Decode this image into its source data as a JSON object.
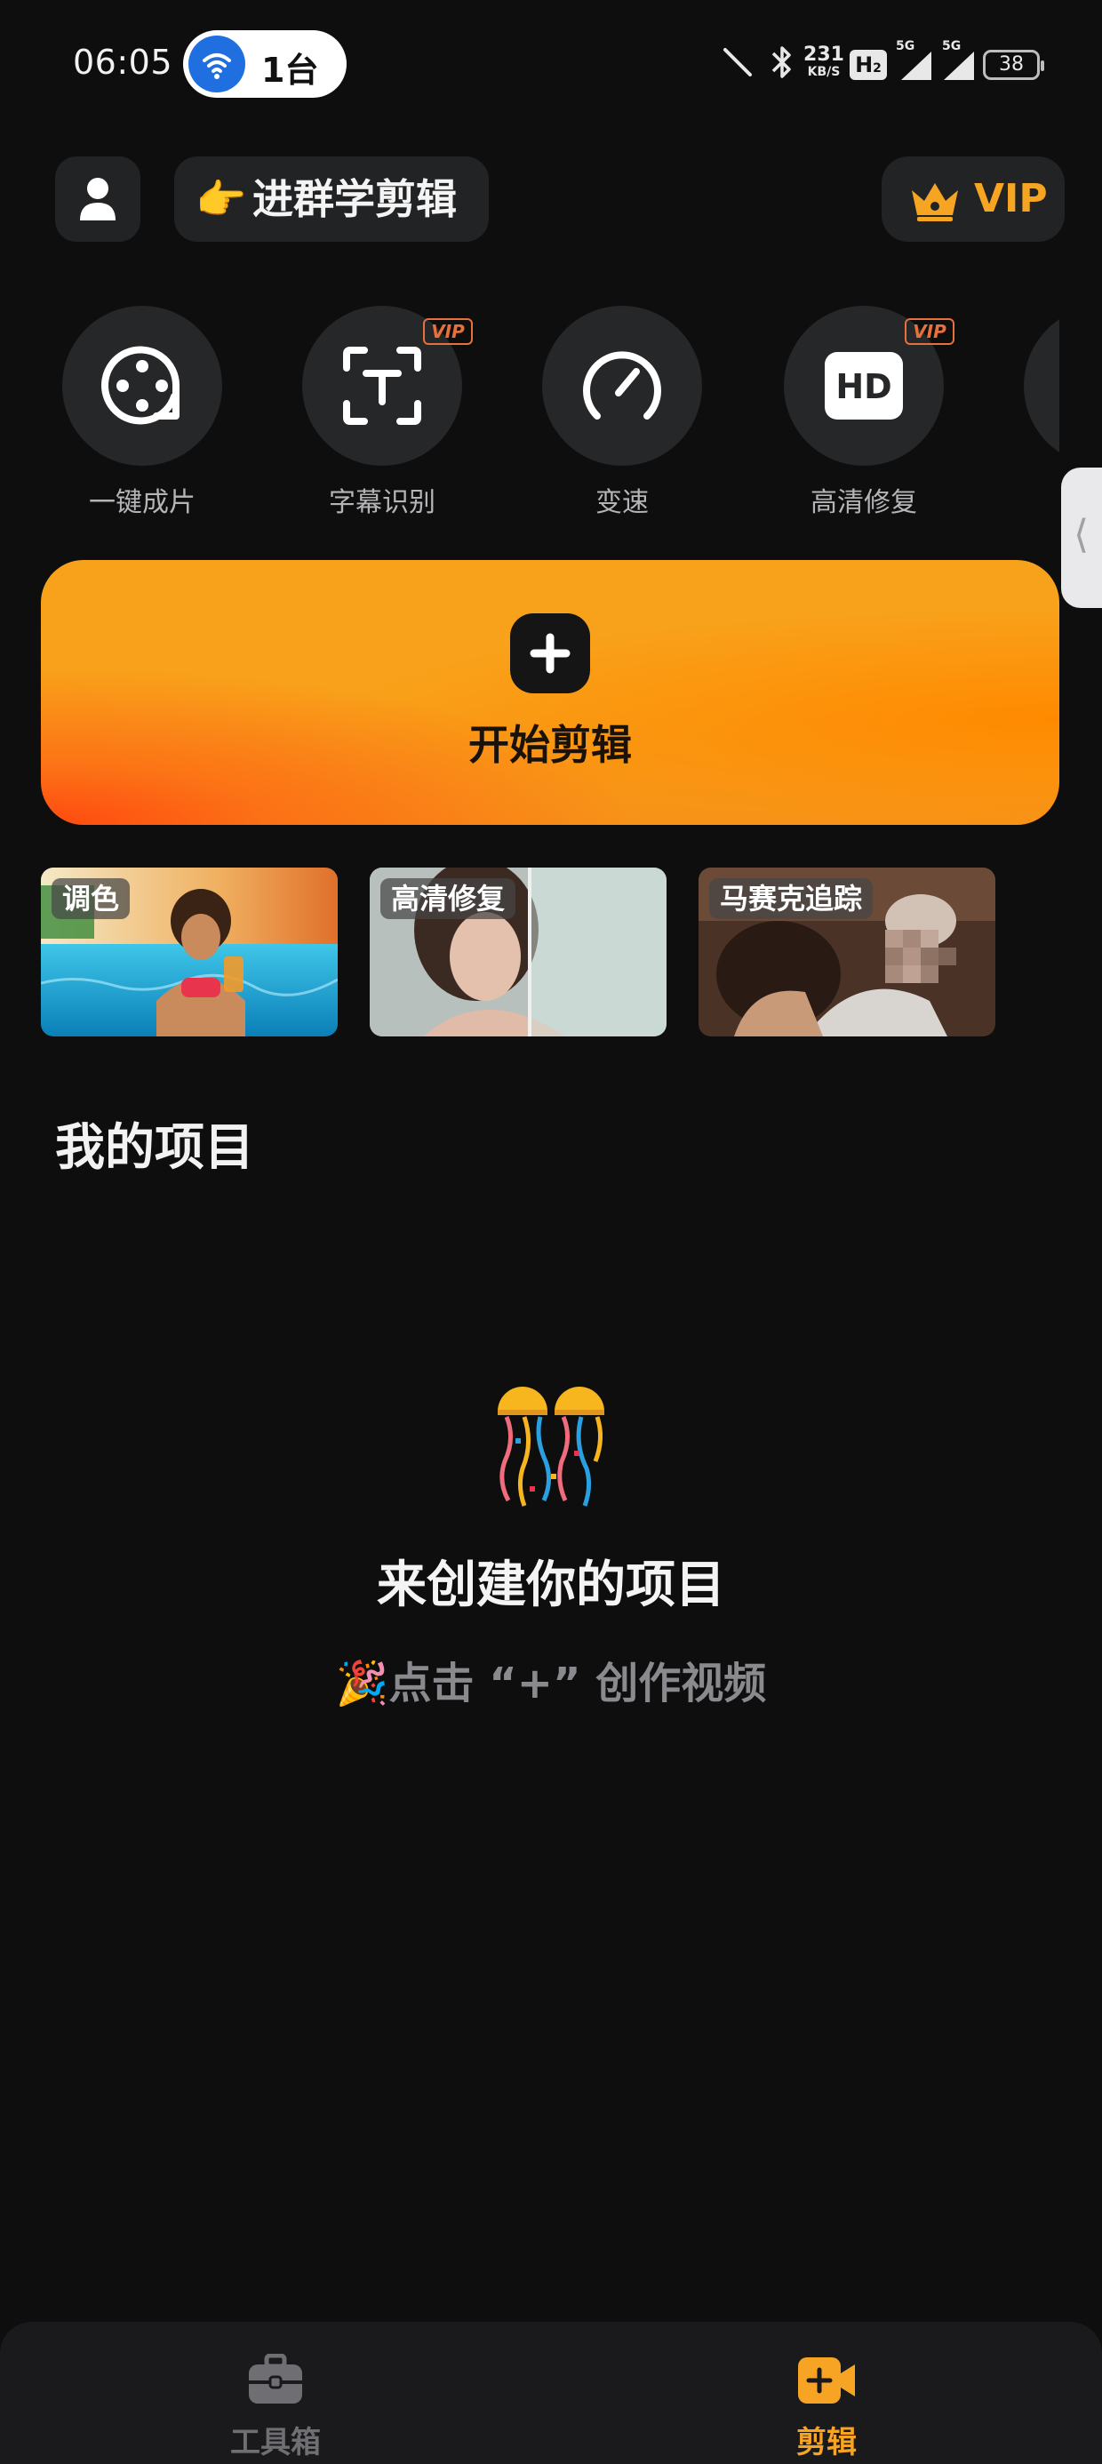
{
  "status_bar": {
    "time": "06:05",
    "hotspot_count": "1台",
    "net_speed_value": "231",
    "net_speed_unit": "KB/S",
    "hd_badge": "H",
    "hd_badge_sub": "2",
    "sim1_label": "5G",
    "sim2_label": "5G",
    "battery": "38"
  },
  "header": {
    "group_emoji": "👉",
    "group_label": "进群学剪辑",
    "vip_label": "VIP"
  },
  "tools": [
    {
      "label": "一键成片",
      "icon": "film-reel-icon",
      "vip": false
    },
    {
      "label": "字幕识别",
      "icon": "text-recognition-icon",
      "vip": true
    },
    {
      "label": "变速",
      "icon": "speedometer-icon",
      "vip": false
    },
    {
      "label": "高清修复",
      "icon": "hd-icon",
      "vip": true
    }
  ],
  "vip_tag_text": "VIP",
  "start_edit": {
    "label": "开始剪辑"
  },
  "templates": [
    {
      "label": "调色"
    },
    {
      "label": "高清修复"
    },
    {
      "label": "马赛克追踪"
    }
  ],
  "projects": {
    "title": "我的项目",
    "empty_emoji": "🎊",
    "empty_title": "来创建你的项目",
    "empty_hint": "🎉点击 “+” 创作视频"
  },
  "bottom_nav": {
    "items": [
      {
        "label": "工具箱",
        "icon": "toolbox-icon",
        "active": false
      },
      {
        "label": "剪辑",
        "icon": "video-add-icon",
        "active": true
      }
    ],
    "active_color": "#f7a425",
    "inactive_color": "#6f6f73"
  },
  "colors": {
    "accent": "#f9a11a",
    "vip_gold": "#f6a522",
    "vip_tag": "#e8703a"
  }
}
